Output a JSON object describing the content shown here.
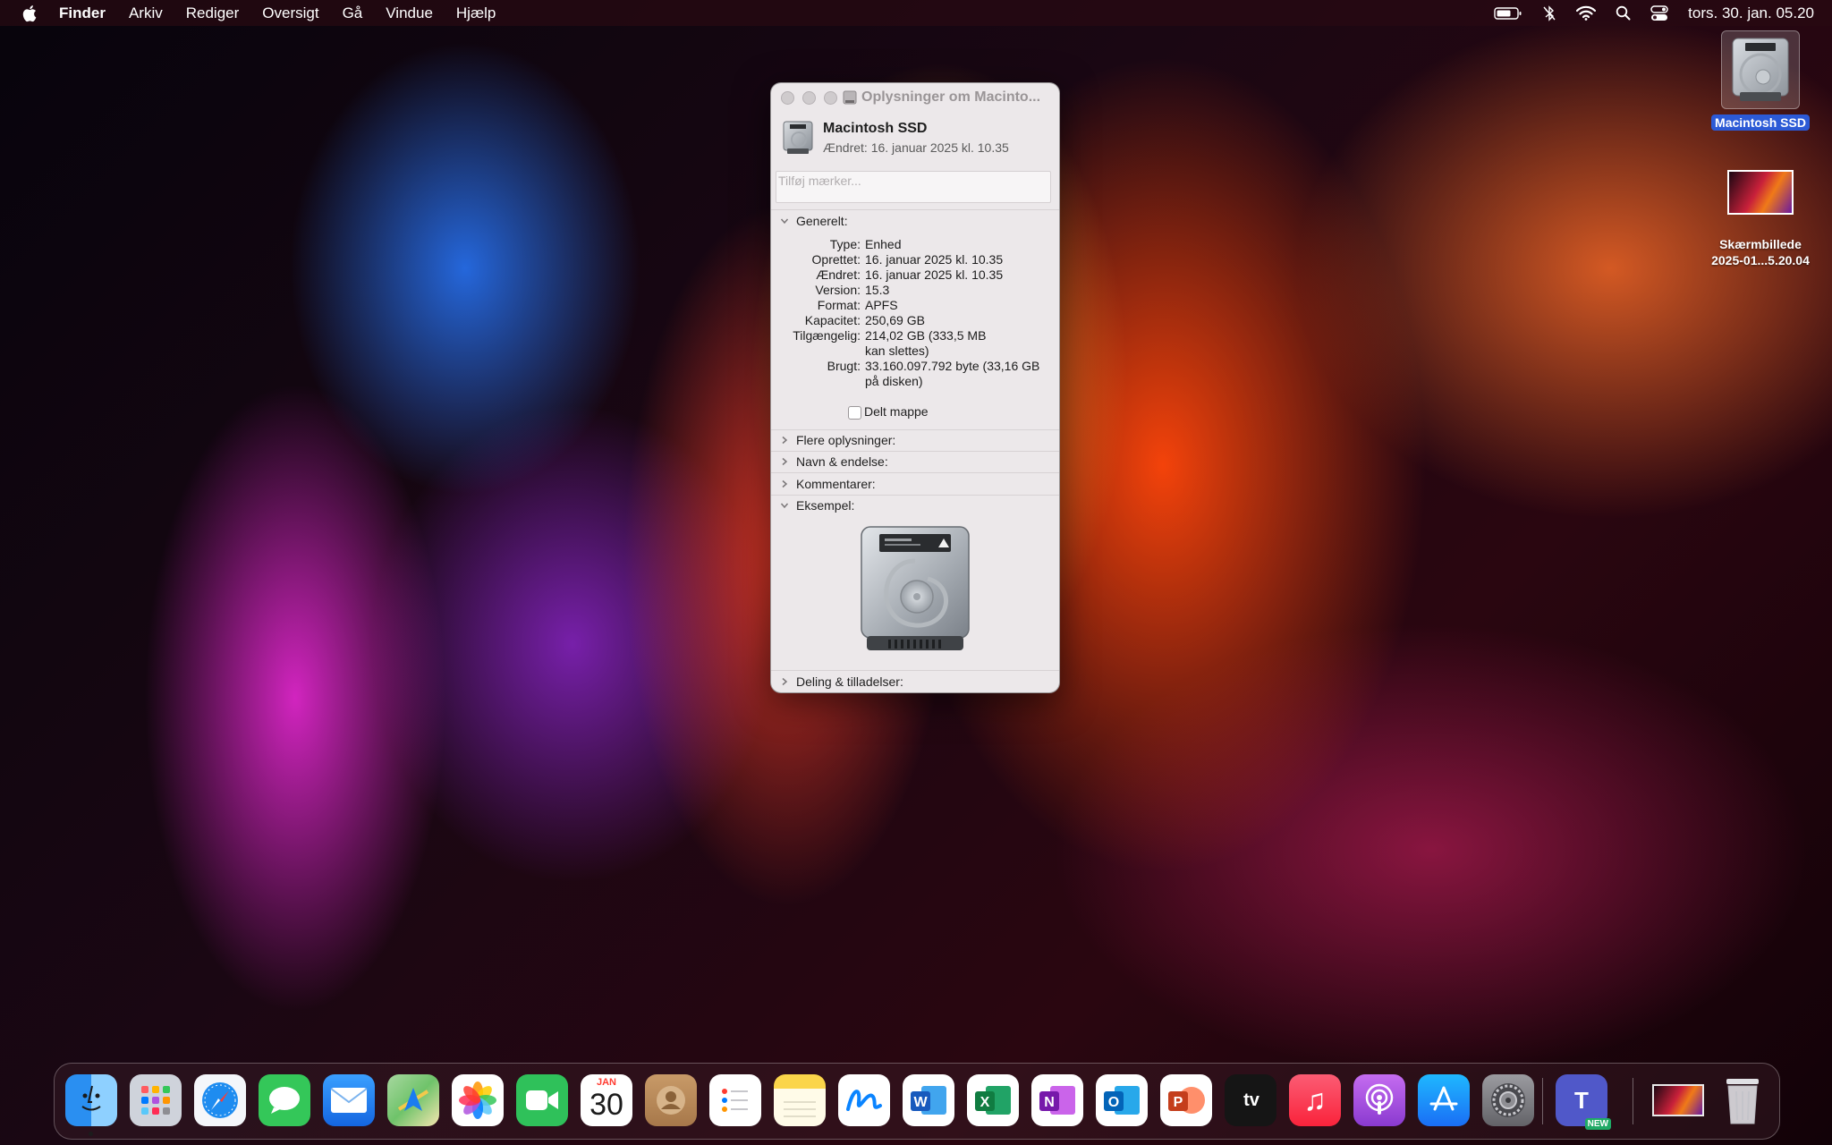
{
  "menubar": {
    "app_name": "Finder",
    "menus": [
      "Arkiv",
      "Rediger",
      "Oversigt",
      "Gå",
      "Vindue",
      "Hjælp"
    ],
    "clock": "tors. 30. jan. 05.20",
    "status_icons": [
      "battery-icon",
      "bluetooth-off-icon",
      "wifi-icon",
      "spotlight-search-icon",
      "control-center-icon"
    ]
  },
  "desktop": {
    "items": [
      {
        "label": "Macintosh SSD",
        "selected": true,
        "icon": "hard-drive-icon"
      },
      {
        "label_line1": "Skærmbillede",
        "label_line2": "2025-01...5.20.04",
        "icon": "screenshot-thumbnail-icon"
      }
    ]
  },
  "info_window": {
    "title": "Oplysninger om Macinto...",
    "name": "Macintosh SSD",
    "modified_line": "Ændret: 16. januar 2025 kl. 10.35",
    "tags_placeholder": "Tilføj mærker...",
    "sections": {
      "general": "Generelt:",
      "more_info": "Flere oplysninger:",
      "name_ext": "Navn & endelse:",
      "comments": "Kommentarer:",
      "preview": "Eksempel:",
      "sharing": "Deling & tilladelser:"
    },
    "general_rows": [
      {
        "key": "Type:",
        "value": "Enhed"
      },
      {
        "key": "Oprettet:",
        "value": "16. januar 2025 kl. 10.35"
      },
      {
        "key": "Ændret:",
        "value": "16. januar 2025 kl. 10.35"
      },
      {
        "key": "Version:",
        "value": "15.3"
      },
      {
        "key": "Format:",
        "value": "APFS"
      },
      {
        "key": "Kapacitet:",
        "value": "250,69 GB"
      },
      {
        "key": "Tilgængelig:",
        "value": "214,02 GB (333,5 MB",
        "value2": "kan slettes)"
      },
      {
        "key": "Brugt:",
        "value": "33.160.097.792 byte (33,16 GB",
        "value2": "på disken)"
      }
    ],
    "shared_folder_label": "Delt mappe"
  },
  "dock": {
    "apps": [
      {
        "name": "Finder",
        "color": "#2b8ff0",
        "glyph": ""
      },
      {
        "name": "Launchpad",
        "color": "#c9cdd6",
        "glyph": ""
      },
      {
        "name": "Safari",
        "color": "#f2f4f8",
        "glyph": ""
      },
      {
        "name": "Beskeder",
        "color": "#34c759",
        "glyph": ""
      },
      {
        "name": "Mail",
        "color": "#1e88f0",
        "glyph": ""
      },
      {
        "name": "Kort",
        "color": "#7cc47a",
        "glyph": ""
      },
      {
        "name": "Fotos",
        "color": "#ffffff",
        "glyph": ""
      },
      {
        "name": "FaceTime",
        "color": "#2fc15a",
        "glyph": ""
      },
      {
        "name": "Kalender",
        "color": "#ffffff",
        "glyph": ""
      },
      {
        "name": "Kontakter",
        "color": "#b78c5e",
        "glyph": ""
      },
      {
        "name": "Påmindelser",
        "color": "#ffffff",
        "glyph": ""
      },
      {
        "name": "Noter",
        "color": "#fbe27a",
        "glyph": ""
      },
      {
        "name": "Freeform",
        "color": "#ffffff",
        "glyph": ""
      },
      {
        "name": "Word",
        "color": "#ffffff",
        "glyph": "W"
      },
      {
        "name": "Excel",
        "color": "#ffffff",
        "glyph": "X"
      },
      {
        "name": "OneNote",
        "color": "#ffffff",
        "glyph": "N"
      },
      {
        "name": "Outlook",
        "color": "#ffffff",
        "glyph": "O"
      },
      {
        "name": "PowerPoint",
        "color": "#ffffff",
        "glyph": "P"
      },
      {
        "name": "TV",
        "color": "#151515",
        "glyph": "tv"
      },
      {
        "name": "Musik",
        "color": "#fa3a55",
        "glyph": "♫"
      },
      {
        "name": "Podcasts",
        "color": "#9a45d8",
        "glyph": ""
      },
      {
        "name": "App Store",
        "color": "#1a8cf5",
        "glyph": ""
      },
      {
        "name": "Systemindstillinger",
        "color": "#8e8e93",
        "glyph": ""
      },
      {
        "name": "Teams",
        "color": "#5058c9",
        "glyph": "T"
      }
    ],
    "calendar_month": "JAN",
    "calendar_day": "30",
    "teams_badge": "NEW",
    "trash": "Papirkurv"
  }
}
